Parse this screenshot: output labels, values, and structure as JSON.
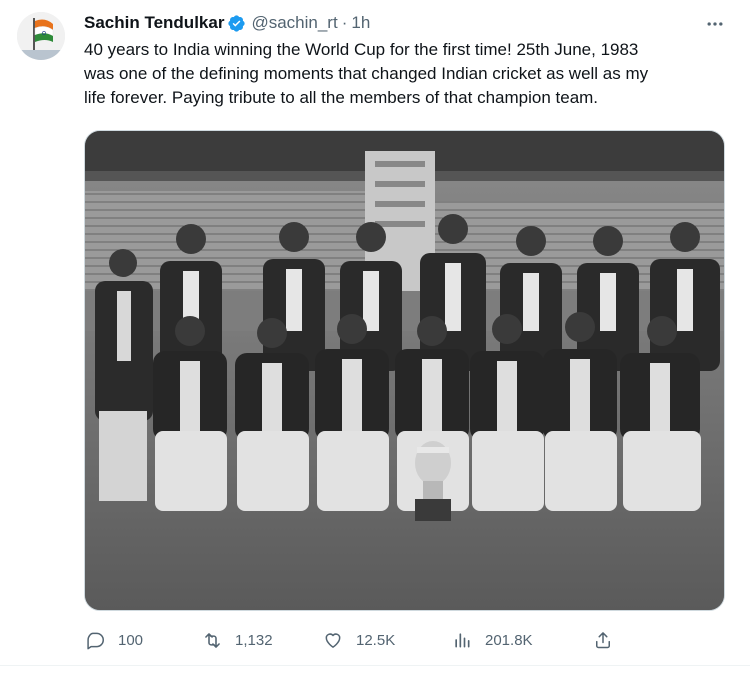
{
  "tweet": {
    "author": {
      "display_name": "Sachin Tendulkar",
      "handle": "@sachin_rt",
      "verified": true,
      "avatar_icon": "indian-flag-avatar"
    },
    "separator": "·",
    "timestamp": "1h",
    "text": "40 years to India winning the World Cup for the first time! 25th June, 1983\nwas one of the defining moments that changed Indian cricket as well as my\nlife forever. Paying tribute to all the members of that champion team.",
    "media": {
      "type": "photo",
      "style": "black-and-white team photograph with trophy"
    },
    "actions": {
      "reply": {
        "icon": "reply-icon",
        "count": "100"
      },
      "retweet": {
        "icon": "retweet-icon",
        "count": "1,132"
      },
      "like": {
        "icon": "heart-icon",
        "count": "12.5K"
      },
      "views": {
        "icon": "views-icon",
        "count": "201.8K"
      },
      "share": {
        "icon": "share-icon"
      }
    },
    "more_icon": "more-icon"
  },
  "colors": {
    "text_primary": "#0f1419",
    "text_secondary": "#536471",
    "verified_blue": "#1d9bf0",
    "border": "#cfd9de"
  }
}
